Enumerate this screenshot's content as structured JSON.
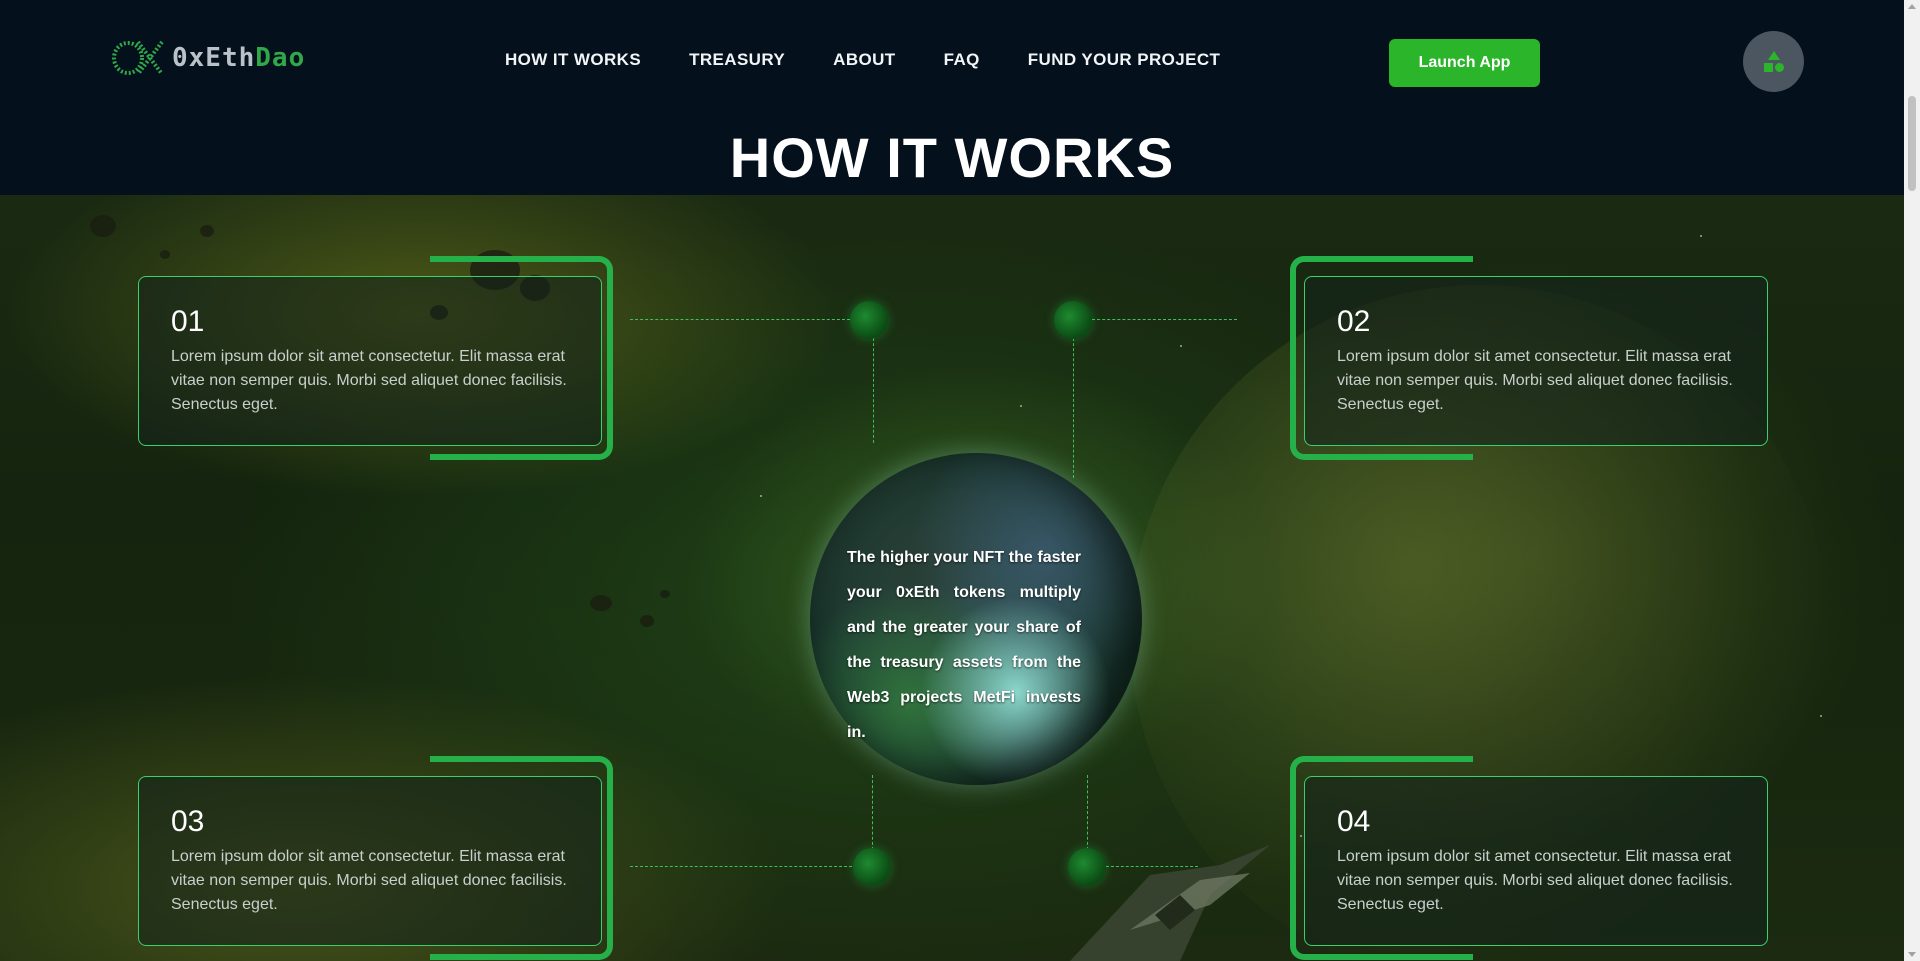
{
  "header": {
    "logo": {
      "prefix": "0xEth",
      "suffix": "Dao"
    },
    "nav": [
      {
        "label": "HOW IT WORKS"
      },
      {
        "label": "TREASURY"
      },
      {
        "label": "ABOUT"
      },
      {
        "label": "FAQ"
      },
      {
        "label": "FUND YOUR PROJECT"
      }
    ],
    "launch_label": "Launch App",
    "avatar_icon": "shapes-icon"
  },
  "section": {
    "title": "HOW IT WORKS",
    "center_text": "The higher your NFT the faster your 0xEth tokens multiply and the greater your share of the treasury assets from the Web3 projects MetFi invests in.",
    "steps": [
      {
        "number": "01",
        "text": "Lorem ipsum dolor sit amet consectetur. Elit massa erat vitae non semper quis. Morbi sed aliquet donec facilisis. Senectus eget."
      },
      {
        "number": "02",
        "text": "Lorem ipsum dolor sit amet consectetur. Elit massa erat vitae non semper quis. Morbi sed aliquet donec facilisis. Senectus eget."
      },
      {
        "number": "03",
        "text": "Lorem ipsum dolor sit amet consectetur. Elit massa erat vitae non semper quis. Morbi sed aliquet donec facilisis. Senectus eget."
      },
      {
        "number": "04",
        "text": "Lorem ipsum dolor sit amet consectetur. Elit massa erat vitae non semper quis. Morbi sed aliquet donec facilisis. Senectus eget."
      }
    ]
  },
  "colors": {
    "accent": "#2ab52a",
    "header_bg": "#04101b",
    "card_border": "#3ad06a"
  }
}
